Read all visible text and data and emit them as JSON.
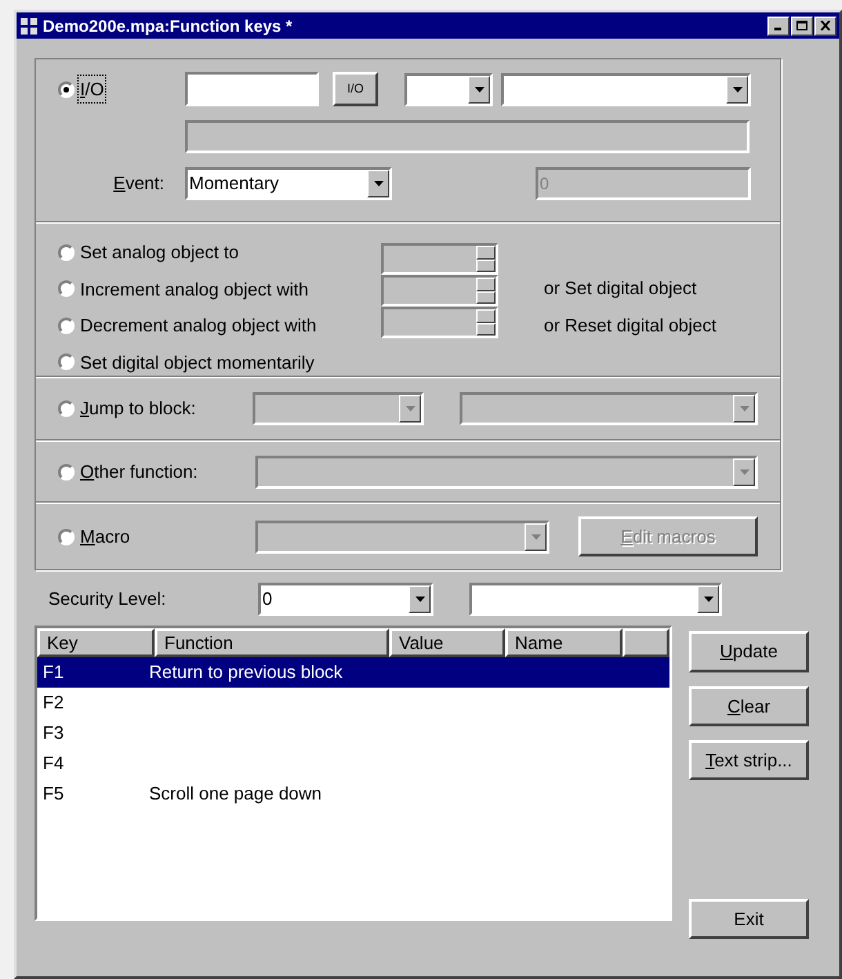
{
  "window": {
    "title": "Demo200e.mpa:Function keys *"
  },
  "io_section": {
    "radio": {
      "label": "I/O",
      "selected": true,
      "mnemonic": true
    },
    "io_button": "I/O",
    "event_label": {
      "label": "Event:",
      "mnemonic": true
    },
    "event_value": "Momentary",
    "value_field": "0"
  },
  "analog_options": [
    {
      "label": "Set analog object to",
      "selected": false
    },
    {
      "label": "Increment analog object with",
      "selected": false,
      "note": "or Set digital object"
    },
    {
      "label": "Decrement analog object with",
      "selected": false,
      "note": "or Reset digital object"
    },
    {
      "label": "Set digital object momentarily",
      "selected": false
    }
  ],
  "jump": {
    "label": "Jump to block:",
    "selected": false,
    "mnemonic": true
  },
  "other": {
    "label": "Other function:",
    "selected": false,
    "mnemonic": true
  },
  "macro": {
    "label": "Macro",
    "selected": false,
    "mnemonic": true,
    "button": {
      "label": "Edit macros",
      "disabled": true,
      "mnemonic": true
    }
  },
  "security": {
    "label": "Security Level:",
    "value": "0"
  },
  "table": {
    "columns": [
      "Key",
      "Function",
      "Value",
      "Name"
    ],
    "rows": [
      {
        "key": "F1",
        "function": "Return to previous block",
        "selected": true
      },
      {
        "key": "F2",
        "function": "",
        "selected": false
      },
      {
        "key": "F3",
        "function": "",
        "selected": false
      },
      {
        "key": "F4",
        "function": "",
        "selected": false
      },
      {
        "key": "F5",
        "function": "Scroll one page down",
        "selected": false
      }
    ]
  },
  "buttons": [
    {
      "label": "Update",
      "mnemonic": true
    },
    {
      "label": "Clear",
      "mnemonic": true
    },
    {
      "label": "Text strip...",
      "mnemonic": true
    },
    {
      "label": "Exit",
      "mnemonic": false
    }
  ]
}
